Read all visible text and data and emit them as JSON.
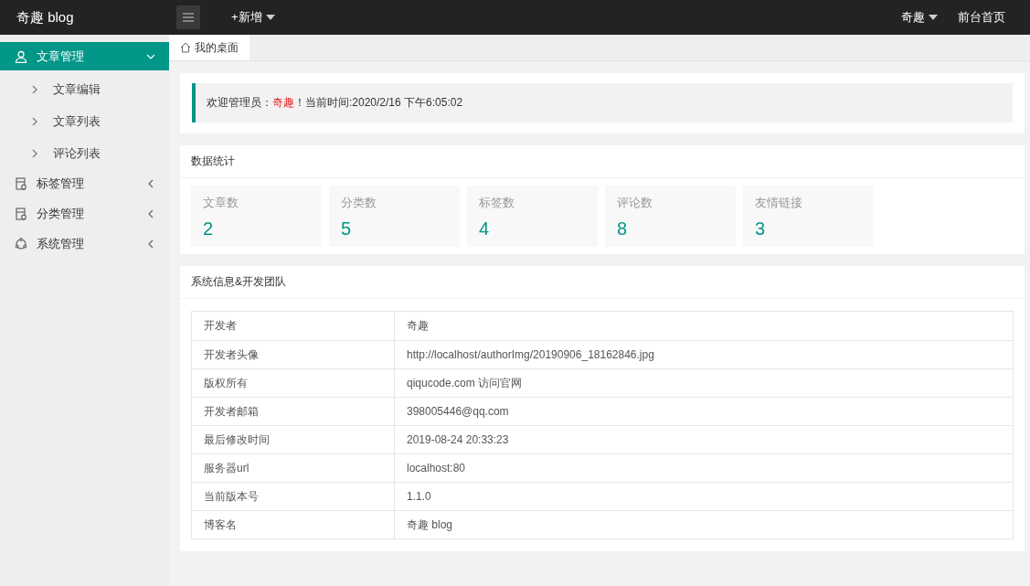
{
  "header": {
    "logo": "奇趣 blog",
    "add_menu": "+新增",
    "user_menu": "奇趣",
    "home_link": "前台首页"
  },
  "sidebar": {
    "items": [
      {
        "label": "文章管理",
        "kind": "user",
        "selected": true,
        "expanded": true,
        "children": [
          {
            "label": "文章编辑"
          },
          {
            "label": "文章列表"
          },
          {
            "label": "评论列表"
          }
        ]
      },
      {
        "label": "标签管理",
        "kind": "doc",
        "selected": false,
        "expanded": false
      },
      {
        "label": "分类管理",
        "kind": "doc",
        "selected": false,
        "expanded": false
      },
      {
        "label": "系统管理",
        "kind": "gear",
        "selected": false,
        "expanded": false
      }
    ]
  },
  "tabs": [
    {
      "label": "我的桌面",
      "selected": true
    }
  ],
  "welcome": {
    "prefix": "欢迎管理员：",
    "user": "奇趣",
    "suffix": "！当前时间:2020/2/16 下午6:05:02"
  },
  "stats": {
    "title": "数据统计",
    "items": [
      {
        "label": "文章数",
        "value": "2"
      },
      {
        "label": "分类数",
        "value": "5"
      },
      {
        "label": "标签数",
        "value": "4"
      },
      {
        "label": "评论数",
        "value": "8"
      },
      {
        "label": "友情链接",
        "value": "3"
      }
    ]
  },
  "system_info": {
    "title": "系统信息&开发团队",
    "rows": [
      {
        "key": "开发者",
        "value": "奇趣"
      },
      {
        "key": "开发者头像",
        "value": "http://localhost/authorImg/20190906_18162846.jpg"
      },
      {
        "key": "版权所有",
        "value": "qiqucode.com 访问官网"
      },
      {
        "key": "开发者邮箱",
        "value": "398005446@qq.com"
      },
      {
        "key": "最后修改时间",
        "value": "2019-08-24 20:33:23"
      },
      {
        "key": "服务器url",
        "value": "localhost:80"
      },
      {
        "key": "当前版本号",
        "value": "1.1.0"
      },
      {
        "key": "博客名",
        "value": "奇趣 blog"
      }
    ]
  }
}
